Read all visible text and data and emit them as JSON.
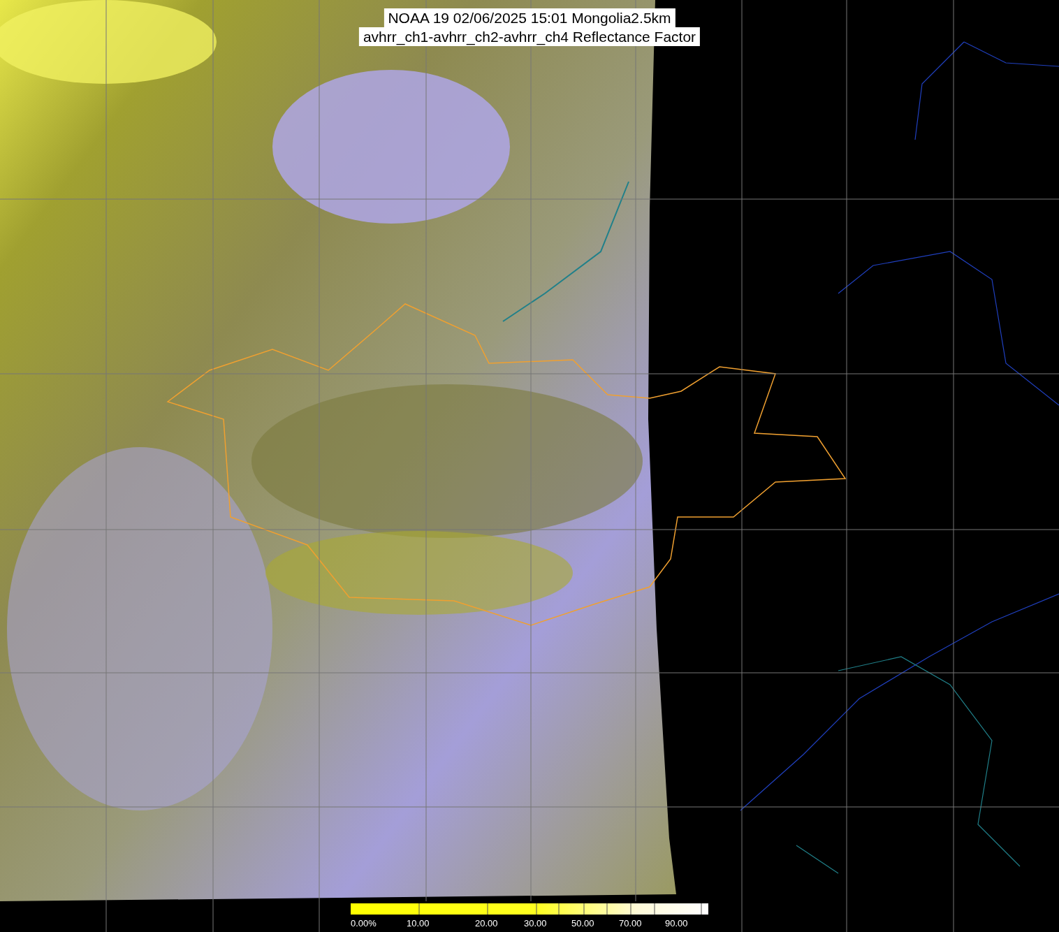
{
  "title": {
    "lines": [
      "NOAA 19 02/06/2025 15:01 Mongolia2.5km",
      "avhrr_ch1-avhrr_ch2-avhrr_ch4 Reflectance Factor"
    ]
  },
  "colorbar": {
    "ticks": [
      "0.00%",
      "10.00",
      "20.00",
      "30.00",
      "50.00",
      "70.00",
      "90.00"
    ]
  }
}
